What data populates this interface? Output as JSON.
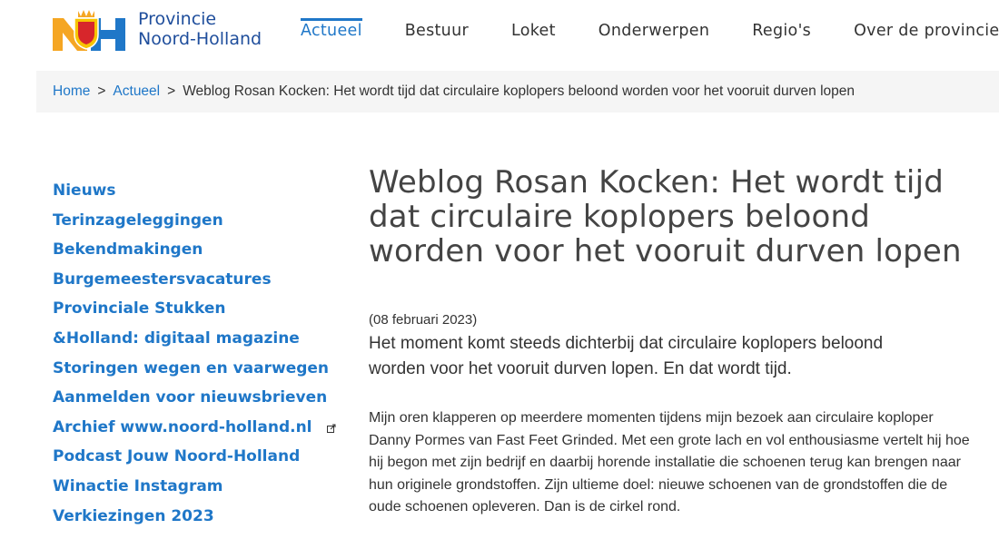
{
  "brand": {
    "logo_letters": "NH",
    "name_line1": "Provincie",
    "name_line2": "Noord-Holland"
  },
  "nav": {
    "items": [
      {
        "label": "Actueel",
        "active": true
      },
      {
        "label": "Bestuur",
        "active": false
      },
      {
        "label": "Loket",
        "active": false
      },
      {
        "label": "Onderwerpen",
        "active": false
      },
      {
        "label": "Regio's",
        "active": false
      },
      {
        "label": "Over de provincie",
        "active": false
      }
    ]
  },
  "breadcrumb": {
    "home": "Home",
    "section": "Actueel",
    "separator": ">",
    "current": "Weblog Rosan Kocken: Het wordt tijd dat circulaire koplopers beloond worden voor het vooruit durven lopen"
  },
  "sidebar": {
    "items": [
      {
        "label": "Nieuws"
      },
      {
        "label": "Terinzageleggingen"
      },
      {
        "label": "Bekendmakingen"
      },
      {
        "label": "Burgemeestersvacatures"
      },
      {
        "label": "Provinciale Stukken"
      },
      {
        "label": "&Holland: digitaal magazine"
      },
      {
        "label": "Storingen wegen en vaarwegen"
      },
      {
        "label": "Aanmelden voor nieuwsbrieven"
      },
      {
        "label": "Archief www.noord-holland.nl"
      },
      {
        "label": "Podcast Jouw Noord-Holland"
      },
      {
        "label": "Winactie Instagram"
      },
      {
        "label": "Verkiezingen 2023"
      }
    ]
  },
  "article": {
    "title": "Weblog Rosan Kocken: Het wordt tijd dat circulaire koplopers beloond worden voor het vooruit durven lopen",
    "date": "(08 februari 2023)",
    "intro": "Het moment komt steeds dichterbij dat circulaire koplopers beloond worden voor het vooruit durven lopen. En dat wordt tijd.",
    "body": "Mijn oren klapperen op meerdere momenten tijdens mijn bezoek aan circulaire koploper Danny Pormes van Fast Feet Grinded. Met een grote lach en vol enthousiasme vertelt hij hoe hij begon met zijn bedrijf en daarbij horende installatie die schoenen terug kan brengen naar hun originele grondstoffen. Zijn ultieme doel: nieuwe schoenen van de grondstoffen die de oude schoenen opleveren. Dan is de cirkel rond."
  },
  "colors": {
    "link_blue": "#1f77c8",
    "brand_blue": "#1f4e9c",
    "brand_orange": "#f5a623",
    "breadcrumb_bg": "#f5f5f5"
  },
  "icons": {
    "external_link": "external-link-icon"
  }
}
